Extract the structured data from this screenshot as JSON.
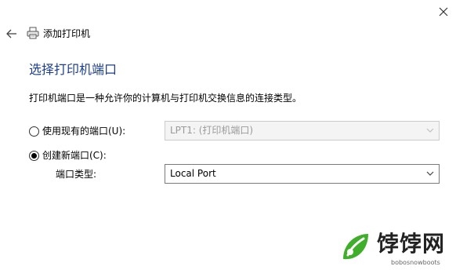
{
  "window": {
    "title": "添加打印机"
  },
  "page": {
    "heading": "选择打印机端口",
    "description": "打印机端口是一种允许你的计算机与打印机交换信息的连接类型。"
  },
  "options": {
    "use_existing": {
      "label": "使用现有的端口(U):",
      "selected": false,
      "value": "LPT1: (打印机端口)",
      "enabled": false
    },
    "create_new": {
      "label": "创建新端口(C):",
      "selected": true
    },
    "port_type": {
      "label": "端口类型:",
      "value": "Local Port"
    }
  },
  "watermark": {
    "brand": "饽饽网",
    "domain": "bobosnowboots"
  },
  "icons": {
    "close": "close-icon",
    "back": "back-arrow-icon",
    "printer": "printer-icon",
    "chevron": "chevron-down-icon",
    "logo": "leaf-logo-icon"
  },
  "colors": {
    "heading": "#1c3f8c",
    "disabled_text": "#9a9a9a",
    "logo_green": "#3fae2a"
  }
}
